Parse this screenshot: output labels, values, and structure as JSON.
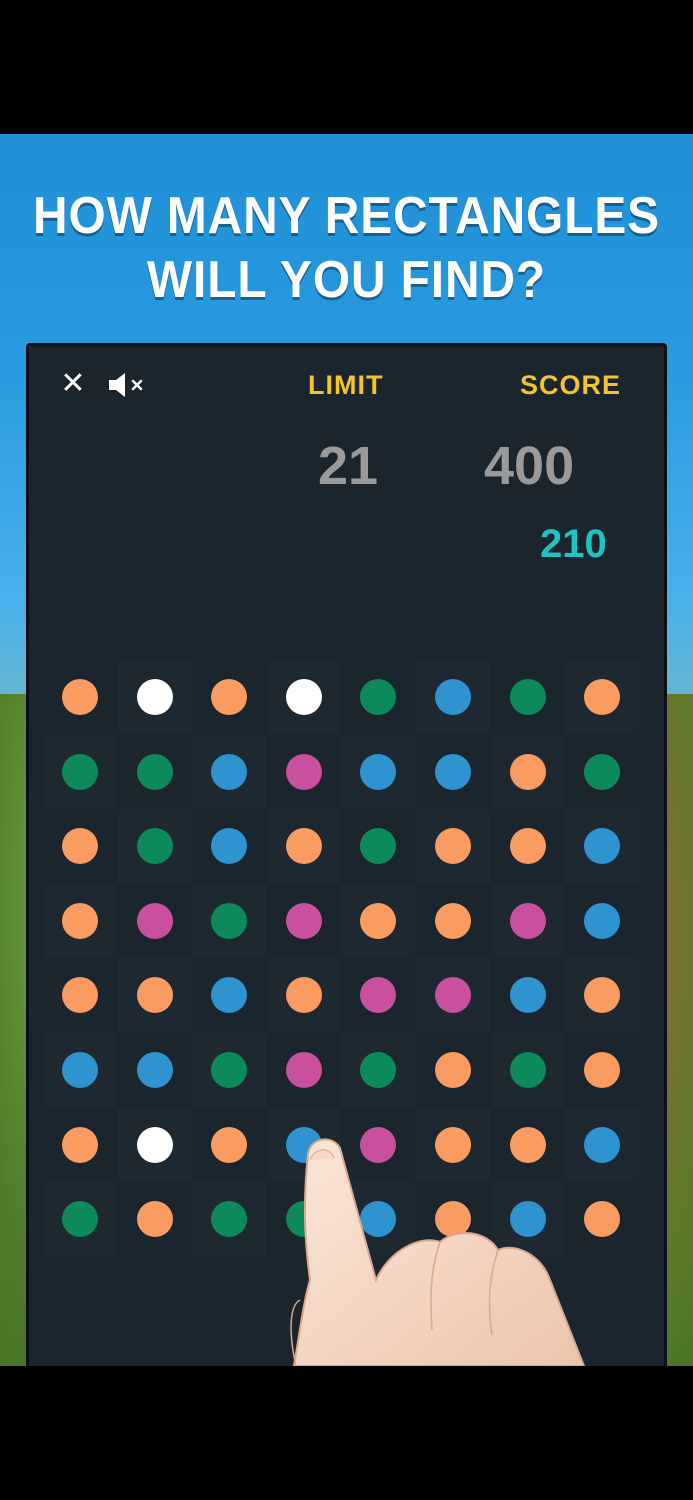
{
  "headline": {
    "line1": "HOW MANY RECTANGLES",
    "line2": "WILL YOU FIND?"
  },
  "hud": {
    "close_glyph": "✕",
    "sound_icon": "speaker-muted-icon",
    "limit_label": "LIMIT",
    "score_label": "SCORE",
    "limit_value": "21",
    "score_value": "400",
    "target_value": "210"
  },
  "colors": {
    "orange": "#fa9b62",
    "white": "#ffffff",
    "green": "#0d8a5c",
    "blue": "#2f93cf",
    "pink": "#c9509c",
    "label": "#f3c42b",
    "score_gray": "#9a9a9a",
    "target_teal": "#1fc4c2",
    "board_bg": "#1b252d"
  },
  "grid": [
    [
      "orange",
      "white",
      "orange",
      "white",
      "green",
      "blue",
      "green",
      "orange"
    ],
    [
      "green",
      "green",
      "blue",
      "pink",
      "blue",
      "blue",
      "orange",
      "green"
    ],
    [
      "orange",
      "green",
      "blue",
      "orange",
      "green",
      "orange",
      "orange",
      "blue"
    ],
    [
      "orange",
      "pink",
      "green",
      "pink",
      "orange",
      "orange",
      "pink",
      "blue"
    ],
    [
      "orange",
      "orange",
      "blue",
      "orange",
      "pink",
      "pink",
      "blue",
      "orange"
    ],
    [
      "blue",
      "blue",
      "green",
      "pink",
      "green",
      "orange",
      "green",
      "orange"
    ],
    [
      "orange",
      "white",
      "orange",
      "blue",
      "pink",
      "orange",
      "orange",
      "blue"
    ],
    [
      "green",
      "orange",
      "green",
      "green",
      "blue",
      "orange",
      "blue",
      "orange"
    ]
  ]
}
